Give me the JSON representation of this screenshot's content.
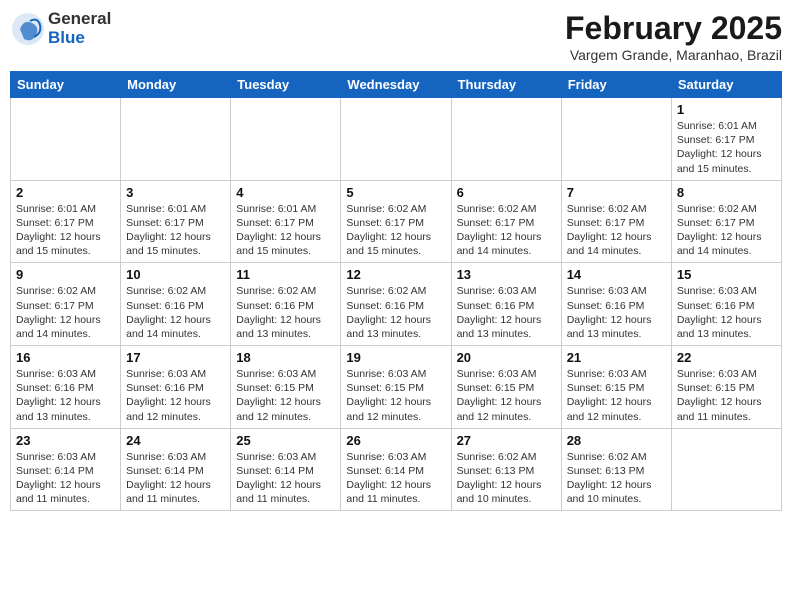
{
  "header": {
    "logo_general": "General",
    "logo_blue": "Blue",
    "month_year": "February 2025",
    "location": "Vargem Grande, Maranhao, Brazil"
  },
  "calendar": {
    "days_of_week": [
      "Sunday",
      "Monday",
      "Tuesday",
      "Wednesday",
      "Thursday",
      "Friday",
      "Saturday"
    ],
    "weeks": [
      [
        {
          "day": "",
          "info": ""
        },
        {
          "day": "",
          "info": ""
        },
        {
          "day": "",
          "info": ""
        },
        {
          "day": "",
          "info": ""
        },
        {
          "day": "",
          "info": ""
        },
        {
          "day": "",
          "info": ""
        },
        {
          "day": "1",
          "info": "Sunrise: 6:01 AM\nSunset: 6:17 PM\nDaylight: 12 hours and 15 minutes."
        }
      ],
      [
        {
          "day": "2",
          "info": "Sunrise: 6:01 AM\nSunset: 6:17 PM\nDaylight: 12 hours and 15 minutes."
        },
        {
          "day": "3",
          "info": "Sunrise: 6:01 AM\nSunset: 6:17 PM\nDaylight: 12 hours and 15 minutes."
        },
        {
          "day": "4",
          "info": "Sunrise: 6:01 AM\nSunset: 6:17 PM\nDaylight: 12 hours and 15 minutes."
        },
        {
          "day": "5",
          "info": "Sunrise: 6:02 AM\nSunset: 6:17 PM\nDaylight: 12 hours and 15 minutes."
        },
        {
          "day": "6",
          "info": "Sunrise: 6:02 AM\nSunset: 6:17 PM\nDaylight: 12 hours and 14 minutes."
        },
        {
          "day": "7",
          "info": "Sunrise: 6:02 AM\nSunset: 6:17 PM\nDaylight: 12 hours and 14 minutes."
        },
        {
          "day": "8",
          "info": "Sunrise: 6:02 AM\nSunset: 6:17 PM\nDaylight: 12 hours and 14 minutes."
        }
      ],
      [
        {
          "day": "9",
          "info": "Sunrise: 6:02 AM\nSunset: 6:17 PM\nDaylight: 12 hours and 14 minutes."
        },
        {
          "day": "10",
          "info": "Sunrise: 6:02 AM\nSunset: 6:16 PM\nDaylight: 12 hours and 14 minutes."
        },
        {
          "day": "11",
          "info": "Sunrise: 6:02 AM\nSunset: 6:16 PM\nDaylight: 12 hours and 13 minutes."
        },
        {
          "day": "12",
          "info": "Sunrise: 6:02 AM\nSunset: 6:16 PM\nDaylight: 12 hours and 13 minutes."
        },
        {
          "day": "13",
          "info": "Sunrise: 6:03 AM\nSunset: 6:16 PM\nDaylight: 12 hours and 13 minutes."
        },
        {
          "day": "14",
          "info": "Sunrise: 6:03 AM\nSunset: 6:16 PM\nDaylight: 12 hours and 13 minutes."
        },
        {
          "day": "15",
          "info": "Sunrise: 6:03 AM\nSunset: 6:16 PM\nDaylight: 12 hours and 13 minutes."
        }
      ],
      [
        {
          "day": "16",
          "info": "Sunrise: 6:03 AM\nSunset: 6:16 PM\nDaylight: 12 hours and 13 minutes."
        },
        {
          "day": "17",
          "info": "Sunrise: 6:03 AM\nSunset: 6:16 PM\nDaylight: 12 hours and 12 minutes."
        },
        {
          "day": "18",
          "info": "Sunrise: 6:03 AM\nSunset: 6:15 PM\nDaylight: 12 hours and 12 minutes."
        },
        {
          "day": "19",
          "info": "Sunrise: 6:03 AM\nSunset: 6:15 PM\nDaylight: 12 hours and 12 minutes."
        },
        {
          "day": "20",
          "info": "Sunrise: 6:03 AM\nSunset: 6:15 PM\nDaylight: 12 hours and 12 minutes."
        },
        {
          "day": "21",
          "info": "Sunrise: 6:03 AM\nSunset: 6:15 PM\nDaylight: 12 hours and 12 minutes."
        },
        {
          "day": "22",
          "info": "Sunrise: 6:03 AM\nSunset: 6:15 PM\nDaylight: 12 hours and 11 minutes."
        }
      ],
      [
        {
          "day": "23",
          "info": "Sunrise: 6:03 AM\nSunset: 6:14 PM\nDaylight: 12 hours and 11 minutes."
        },
        {
          "day": "24",
          "info": "Sunrise: 6:03 AM\nSunset: 6:14 PM\nDaylight: 12 hours and 11 minutes."
        },
        {
          "day": "25",
          "info": "Sunrise: 6:03 AM\nSunset: 6:14 PM\nDaylight: 12 hours and 11 minutes."
        },
        {
          "day": "26",
          "info": "Sunrise: 6:03 AM\nSunset: 6:14 PM\nDaylight: 12 hours and 11 minutes."
        },
        {
          "day": "27",
          "info": "Sunrise: 6:02 AM\nSunset: 6:13 PM\nDaylight: 12 hours and 10 minutes."
        },
        {
          "day": "28",
          "info": "Sunrise: 6:02 AM\nSunset: 6:13 PM\nDaylight: 12 hours and 10 minutes."
        },
        {
          "day": "",
          "info": ""
        }
      ]
    ]
  }
}
